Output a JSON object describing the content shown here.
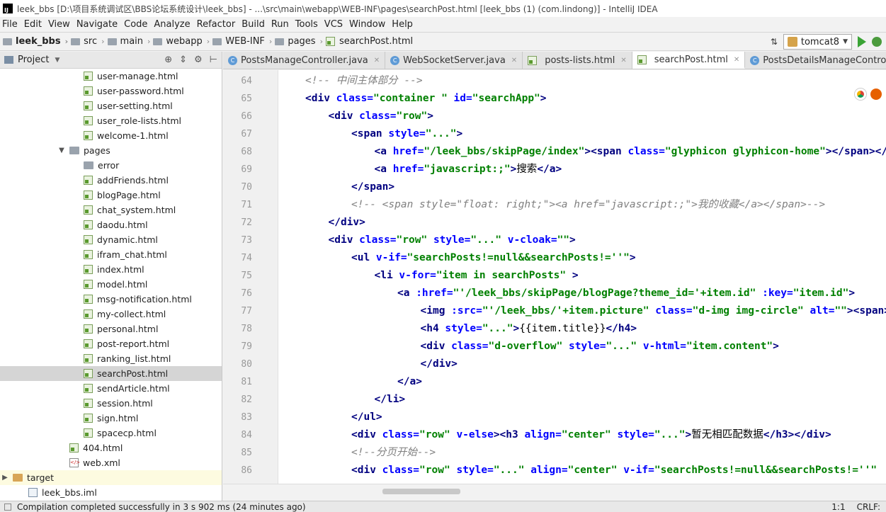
{
  "window": {
    "title": "leek_bbs [D:\\项目系统调试区\\BBS论坛系统设计\\leek_bbs] - ...\\src\\main\\webapp\\WEB-INF\\pages\\searchPost.html [leek_bbs (1) (com.lindong)] - IntelliJ IDEA"
  },
  "menu": [
    "File",
    "Edit",
    "View",
    "Navigate",
    "Code",
    "Analyze",
    "Refactor",
    "Build",
    "Run",
    "Tools",
    "VCS",
    "Window",
    "Help"
  ],
  "breadcrumbs": [
    "leek_bbs",
    "src",
    "main",
    "webapp",
    "WEB-INF",
    "pages",
    "searchPost.html"
  ],
  "run_config": "tomcat8",
  "project_panel": {
    "title": "Project",
    "tree": [
      {
        "label": "user-manage.html",
        "type": "html",
        "indent": 3
      },
      {
        "label": "user-password.html",
        "type": "html",
        "indent": 3
      },
      {
        "label": "user-setting.html",
        "type": "html",
        "indent": 3
      },
      {
        "label": "user_role-lists.html",
        "type": "html",
        "indent": 3
      },
      {
        "label": "welcome-1.html",
        "type": "html",
        "indent": 3
      },
      {
        "label": "pages",
        "type": "folder-open",
        "indent": 2
      },
      {
        "label": "error",
        "type": "folder",
        "indent": 3
      },
      {
        "label": "addFriends.html",
        "type": "html",
        "indent": 3
      },
      {
        "label": "blogPage.html",
        "type": "html",
        "indent": 3
      },
      {
        "label": "chat_system.html",
        "type": "html",
        "indent": 3
      },
      {
        "label": "daodu.html",
        "type": "html",
        "indent": 3
      },
      {
        "label": "dynamic.html",
        "type": "html",
        "indent": 3
      },
      {
        "label": "ifram_chat.html",
        "type": "html",
        "indent": 3
      },
      {
        "label": "index.html",
        "type": "html",
        "indent": 3
      },
      {
        "label": "model.html",
        "type": "html",
        "indent": 3
      },
      {
        "label": "msg-notification.html",
        "type": "html",
        "indent": 3
      },
      {
        "label": "my-collect.html",
        "type": "html",
        "indent": 3
      },
      {
        "label": "personal.html",
        "type": "html",
        "indent": 3
      },
      {
        "label": "post-report.html",
        "type": "html",
        "indent": 3
      },
      {
        "label": "ranking_list.html",
        "type": "html",
        "indent": 3
      },
      {
        "label": "searchPost.html",
        "type": "html",
        "indent": 3,
        "selected": true
      },
      {
        "label": "sendArticle.html",
        "type": "html",
        "indent": 3
      },
      {
        "label": "session.html",
        "type": "html",
        "indent": 3
      },
      {
        "label": "sign.html",
        "type": "html",
        "indent": 3
      },
      {
        "label": "spacecp.html",
        "type": "html",
        "indent": 3
      },
      {
        "label": "404.html",
        "type": "html",
        "indent": 2
      },
      {
        "label": "web.xml",
        "type": "xml",
        "indent": 2
      },
      {
        "label": "target",
        "type": "folder-target",
        "indent": 0,
        "highlight": true
      },
      {
        "label": "leek_bbs.iml",
        "type": "iml",
        "indent": 1
      }
    ]
  },
  "tabs": [
    {
      "label": "PostsManageController.java",
      "icon": "class-icon",
      "active": false
    },
    {
      "label": "WebSocketServer.java",
      "icon": "class-icon",
      "active": false
    },
    {
      "label": "posts-lists.html",
      "icon": "html-icon",
      "active": false
    },
    {
      "label": "searchPost.html",
      "icon": "html-icon",
      "active": true
    },
    {
      "label": "PostsDetailsManageController.java",
      "icon": "class-icon",
      "active": false
    }
  ],
  "editor": {
    "line_numbers": [
      "64",
      "65",
      "66",
      "67",
      "68",
      "69",
      "70",
      "71",
      "72",
      "73",
      "74",
      "75",
      "76",
      "77",
      "78",
      "79",
      "80",
      "81",
      "82",
      "83",
      "84",
      "85",
      "86"
    ],
    "lines": [
      {
        "indent": 0,
        "segs": [
          [
            "cmt",
            "<!-- 中间主体部分 -->"
          ]
        ]
      },
      {
        "indent": 0,
        "segs": [
          [
            "tag",
            "<div "
          ],
          [
            "attr",
            "class="
          ],
          [
            "val",
            "\"container \" "
          ],
          [
            "attr",
            "id="
          ],
          [
            "val",
            "\"searchApp\""
          ],
          [
            "tag",
            ">"
          ]
        ]
      },
      {
        "indent": 1,
        "segs": [
          [
            "tag",
            "<div "
          ],
          [
            "attr",
            "class="
          ],
          [
            "val",
            "\"row\""
          ],
          [
            "tag",
            ">"
          ]
        ]
      },
      {
        "indent": 2,
        "segs": [
          [
            "tag",
            "<span "
          ],
          [
            "attr",
            "style="
          ],
          [
            "val",
            "\"...\""
          ],
          [
            "tag",
            ">"
          ]
        ]
      },
      {
        "indent": 3,
        "segs": [
          [
            "tag",
            "<a "
          ],
          [
            "attr",
            "href="
          ],
          [
            "val",
            "\"/leek_bbs/skipPage/index\""
          ],
          [
            "tag",
            ">"
          ],
          [
            "tag",
            "<span "
          ],
          [
            "attr",
            "class="
          ],
          [
            "val",
            "\"glyphicon glyphicon-home\""
          ],
          [
            "tag",
            "></span></a>"
          ]
        ]
      },
      {
        "indent": 3,
        "segs": [
          [
            "tag",
            "<a "
          ],
          [
            "attr",
            "href="
          ],
          [
            "val",
            "\"javascript:;\""
          ],
          [
            "tag",
            ">"
          ],
          [
            "txt",
            "搜索"
          ],
          [
            "tag",
            "</a>"
          ]
        ]
      },
      {
        "indent": 2,
        "segs": [
          [
            "tag",
            "</span>"
          ]
        ]
      },
      {
        "indent": 2,
        "segs": [
          [
            "cmt",
            "<!-- <span style=\"float: right;\"><a href=\"javascript:;\">我的收藏</a></span>-->"
          ]
        ]
      },
      {
        "indent": 1,
        "segs": [
          [
            "tag",
            "</div>"
          ]
        ]
      },
      {
        "indent": 1,
        "segs": [
          [
            "tag",
            "<div "
          ],
          [
            "attr",
            "class="
          ],
          [
            "val",
            "\"row\" "
          ],
          [
            "attr",
            "style="
          ],
          [
            "val",
            "\"...\" "
          ],
          [
            "attr",
            "v-cloak="
          ],
          [
            "val",
            "\"\""
          ],
          [
            "tag",
            ">"
          ]
        ]
      },
      {
        "indent": 2,
        "segs": [
          [
            "tag",
            "<ul "
          ],
          [
            "attr",
            "v-if="
          ],
          [
            "val",
            "\"searchPosts!=null&&searchPosts!=''\""
          ],
          [
            "tag",
            ">"
          ]
        ]
      },
      {
        "indent": 3,
        "segs": [
          [
            "tag",
            "<li "
          ],
          [
            "attr",
            "v-for="
          ],
          [
            "val",
            "\"item in searchPosts\" "
          ],
          [
            "tag",
            ">"
          ]
        ]
      },
      {
        "indent": 4,
        "segs": [
          [
            "tag",
            "<a "
          ],
          [
            "attr",
            ":href="
          ],
          [
            "val",
            "\"'/leek_bbs/skipPage/blogPage?theme_id='+item.id\" "
          ],
          [
            "attr",
            ":key="
          ],
          [
            "val",
            "\"item.id\""
          ],
          [
            "tag",
            ">"
          ]
        ]
      },
      {
        "indent": 5,
        "segs": [
          [
            "tag",
            "<img "
          ],
          [
            "attr",
            ":src="
          ],
          [
            "val",
            "\"'/leek_bbs/'+item.picture\" "
          ],
          [
            "attr",
            "class="
          ],
          [
            "val",
            "\"d-img img-circle\" "
          ],
          [
            "attr",
            "alt="
          ],
          [
            "val",
            "\"\""
          ],
          [
            "tag",
            "><span></span>"
          ]
        ]
      },
      {
        "indent": 5,
        "segs": [
          [
            "tag",
            "<h4 "
          ],
          [
            "attr",
            "style="
          ],
          [
            "val",
            "\"...\""
          ],
          [
            "tag",
            ">"
          ],
          [
            "txt",
            "{{item.title}}"
          ],
          [
            "tag",
            "</h4>"
          ]
        ]
      },
      {
        "indent": 5,
        "segs": [
          [
            "tag",
            "<div "
          ],
          [
            "attr",
            "class="
          ],
          [
            "val",
            "\"d-overflow\" "
          ],
          [
            "attr",
            "style="
          ],
          [
            "val",
            "\"...\" "
          ],
          [
            "attr",
            "v-html="
          ],
          [
            "val",
            "\"item.content\""
          ],
          [
            "tag",
            ">"
          ]
        ]
      },
      {
        "indent": 5,
        "segs": [
          [
            "tag",
            "</div>"
          ]
        ]
      },
      {
        "indent": 4,
        "segs": [
          [
            "tag",
            "</a>"
          ]
        ]
      },
      {
        "indent": 3,
        "segs": [
          [
            "tag",
            "</li>"
          ]
        ]
      },
      {
        "indent": 2,
        "segs": [
          [
            "tag",
            "</ul>"
          ]
        ]
      },
      {
        "indent": 2,
        "segs": [
          [
            "tag",
            "<div "
          ],
          [
            "attr",
            "class="
          ],
          [
            "val",
            "\"row\" "
          ],
          [
            "attr",
            "v-else"
          ],
          [
            "tag",
            "><h3 "
          ],
          [
            "attr",
            "align="
          ],
          [
            "val",
            "\"center\" "
          ],
          [
            "attr",
            "style="
          ],
          [
            "val",
            "\"...\""
          ],
          [
            "tag",
            ">"
          ],
          [
            "txt",
            "暂无相匹配数据"
          ],
          [
            "tag",
            "</h3></div>"
          ]
        ]
      },
      {
        "indent": 2,
        "segs": [
          [
            "cmt",
            "<!--分页开始-->"
          ]
        ]
      },
      {
        "indent": 2,
        "segs": [
          [
            "tag",
            "<div "
          ],
          [
            "attr",
            "class="
          ],
          [
            "val",
            "\"row\" "
          ],
          [
            "attr",
            "style="
          ],
          [
            "val",
            "\"...\" "
          ],
          [
            "attr",
            "align="
          ],
          [
            "val",
            "\"center\" "
          ],
          [
            "attr",
            "v-if="
          ],
          [
            "val",
            "\"searchPosts!=null&&searchPosts!=''\""
          ]
        ]
      }
    ]
  },
  "status": {
    "message": "Compilation completed successfully in 3 s 902 ms (24 minutes ago)",
    "position": "1:1",
    "line_sep": "CRLF:"
  }
}
